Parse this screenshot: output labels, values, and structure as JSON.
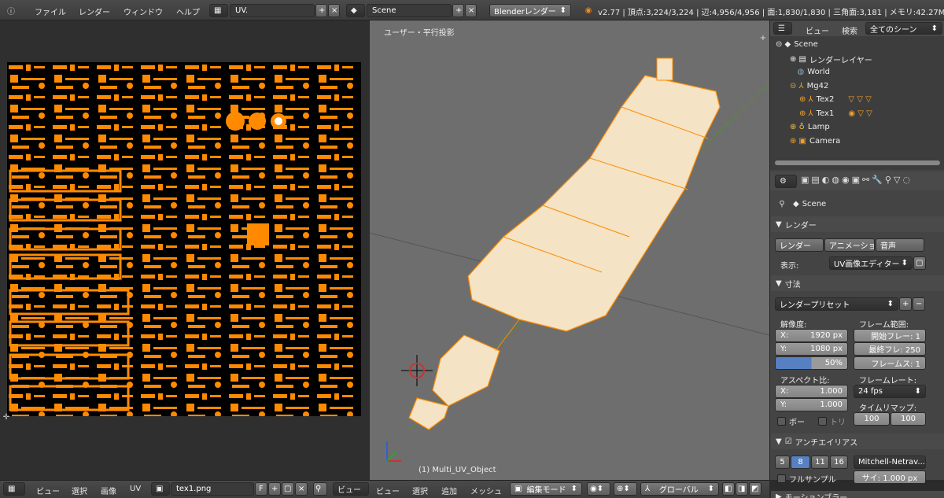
{
  "topbar": {
    "menus": [
      "ファイル",
      "レンダー",
      "ウィンドウ",
      "ヘルプ"
    ],
    "screen_name": "UV.",
    "scene_name": "Scene",
    "engine": "Blenderレンダー",
    "stats": "v2.77 | 頂点:3,224/3,224 | 辺:4,956/4,956 | 面:1,830/1,830 | 三角面:3,181 | メモリ:42.27M | Mu"
  },
  "viewport": {
    "view_label": "ユーザー・平行投影",
    "object_label": "(1) Multi_UV_Object"
  },
  "outliner": {
    "menus": [
      "ビュー",
      "検索"
    ],
    "filter": "全てのシーン",
    "items": [
      "Scene",
      "レンダーレイヤー",
      "World",
      "Mg42",
      "Tex2",
      "Tex1",
      "Lamp",
      "Camera"
    ]
  },
  "properties": {
    "scene_label": "Scene",
    "render_section": "レンダー",
    "render_btn": "レンダー",
    "anim_btn": "アニメーショ",
    "audio_btn": "音声",
    "display_label": "表示:",
    "display_value": "UV画像エディター",
    "dimensions_section": "寸法",
    "preset": "レンダープリセット",
    "resolution_label": "解像度:",
    "res_x": "X:",
    "res_x_val": "1920 px",
    "res_y": "Y:",
    "res_y_val": "1080 px",
    "res_pct": "50%",
    "frame_range_label": "フレーム範囲:",
    "frame_start": "開始フレー: 1",
    "frame_end": "最終フレ: 250",
    "frame_step": "フレームス: 1",
    "aspect_label": "アスペクト比:",
    "asp_x": "X:",
    "asp_x_val": "1.000",
    "asp_y": "Y:",
    "asp_y_val": "1.000",
    "framerate_label": "フレームレート:",
    "framerate": "24 fps",
    "timeremap_label": "タイムリマップ:",
    "remap_old": "100",
    "remap_new": "100",
    "border": "ボー",
    "crop": "トリ",
    "aa_section": "アンチエイリアス",
    "aa_samples": [
      "5",
      "8",
      "11",
      "16"
    ],
    "aa_filter": "Mitchell-Netrav...",
    "full_sample": "フルサンプル",
    "filter_size": "サイ: 1.000 px",
    "motion_section": "モーションブラー"
  },
  "uv_bottom": {
    "menus": [
      "ビュー",
      "選択",
      "画像",
      "UV"
    ],
    "image": "tex1.png",
    "fake_user": "F",
    "view_btn": "ビュー"
  },
  "viewport_bottom": {
    "menus": [
      "ビュー",
      "選択",
      "追加",
      "メッシュ"
    ],
    "mode": "編集モード",
    "orientation": "グローバル"
  },
  "colors": {
    "accent": "#ff8a00",
    "selected_blue": "#5680c2",
    "viewport_bg": "#6e6e6e"
  }
}
